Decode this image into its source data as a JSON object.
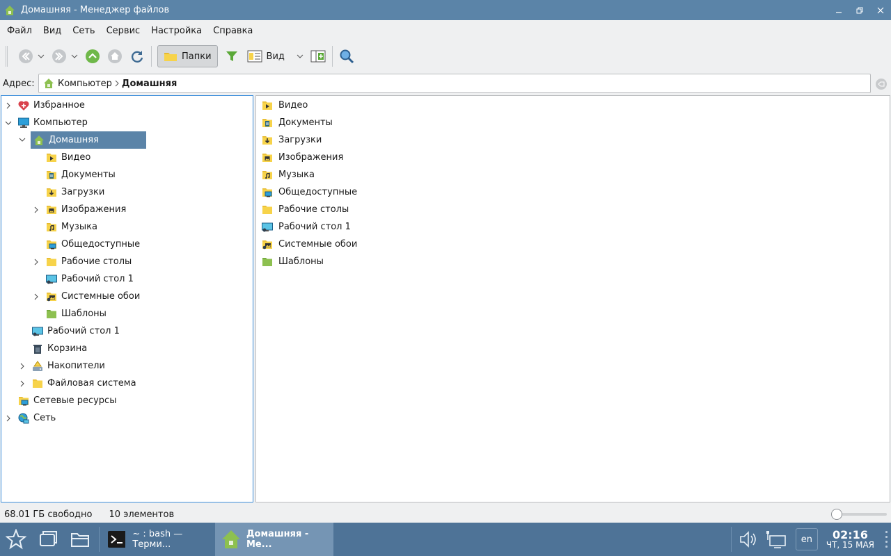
{
  "window": {
    "title": "Домашняя - Менеджер файлов"
  },
  "menu": [
    "Файл",
    "Вид",
    "Сеть",
    "Сервис",
    "Настройка",
    "Справка"
  ],
  "toolbar": {
    "folders_label": "Папки",
    "view_label": "Вид"
  },
  "address": {
    "label": "Адрес:",
    "crumbs": [
      "Компьютер",
      "Домашняя"
    ]
  },
  "tree": [
    {
      "label": "Избранное",
      "icon": "favorites-icon",
      "depth": 0,
      "expander": "closed"
    },
    {
      "label": "Компьютер",
      "icon": "computer-icon",
      "depth": 0,
      "expander": "open"
    },
    {
      "label": "Домашняя",
      "icon": "home-icon",
      "depth": 1,
      "expander": "open",
      "selected": true
    },
    {
      "label": "Видео",
      "icon": "video-folder-icon",
      "depth": 2,
      "expander": "none"
    },
    {
      "label": "Документы",
      "icon": "documents-folder-icon",
      "depth": 2,
      "expander": "none"
    },
    {
      "label": "Загрузки",
      "icon": "downloads-folder-icon",
      "depth": 2,
      "expander": "none"
    },
    {
      "label": "Изображения",
      "icon": "pictures-folder-icon",
      "depth": 2,
      "expander": "closed"
    },
    {
      "label": "Музыка",
      "icon": "music-folder-icon",
      "depth": 2,
      "expander": "none"
    },
    {
      "label": "Общедоступные",
      "icon": "public-folder-icon",
      "depth": 2,
      "expander": "none"
    },
    {
      "label": "Рабочие столы",
      "icon": "folder-icon",
      "depth": 2,
      "expander": "closed"
    },
    {
      "label": "Рабочий стол 1",
      "icon": "desktop-icon",
      "depth": 2,
      "expander": "none"
    },
    {
      "label": "Системные обои",
      "icon": "wallpapers-folder-icon",
      "depth": 2,
      "expander": "closed"
    },
    {
      "label": "Шаблоны",
      "icon": "templates-folder-icon",
      "depth": 2,
      "expander": "none"
    },
    {
      "label": "Рабочий стол 1",
      "icon": "desktop-icon",
      "depth": 1,
      "expander": "none"
    },
    {
      "label": "Корзина",
      "icon": "trash-icon",
      "depth": 1,
      "expander": "none"
    },
    {
      "label": "Накопители",
      "icon": "drives-icon",
      "depth": 1,
      "expander": "closed"
    },
    {
      "label": "Файловая система",
      "icon": "folder-icon",
      "depth": 1,
      "expander": "closed"
    },
    {
      "label": "Сетевые ресурсы",
      "icon": "network-shares-icon",
      "depth": 0,
      "expander": "none"
    },
    {
      "label": "Сеть",
      "icon": "network-icon",
      "depth": 0,
      "expander": "closed"
    }
  ],
  "files": [
    {
      "label": "Видео",
      "icon": "video-folder-icon"
    },
    {
      "label": "Документы",
      "icon": "documents-folder-icon"
    },
    {
      "label": "Загрузки",
      "icon": "downloads-folder-icon"
    },
    {
      "label": "Изображения",
      "icon": "pictures-folder-icon"
    },
    {
      "label": "Музыка",
      "icon": "music-folder-icon"
    },
    {
      "label": "Общедоступные",
      "icon": "public-folder-icon"
    },
    {
      "label": "Рабочие столы",
      "icon": "folder-icon"
    },
    {
      "label": "Рабочий стол 1",
      "icon": "desktop-icon"
    },
    {
      "label": "Системные обои",
      "icon": "wallpapers-folder-icon"
    },
    {
      "label": "Шаблоны",
      "icon": "templates-folder-icon"
    }
  ],
  "status": {
    "free_space": "68.01 ГБ свободно",
    "count": "10 элементов"
  },
  "taskbar": {
    "tasks": [
      {
        "label": "~ : bash — Терми...",
        "icon": "terminal-icon",
        "active": false
      },
      {
        "label": "Домашняя - Ме...",
        "icon": "home-icon",
        "active": true
      }
    ],
    "lang": "en",
    "time": "02:16",
    "date": "ЧТ, 15 МАЯ"
  },
  "colors": {
    "accent": "#5b84a8",
    "taskbar": "#4e7397",
    "folder": "#f7d34a",
    "templates": "#8dc050"
  }
}
